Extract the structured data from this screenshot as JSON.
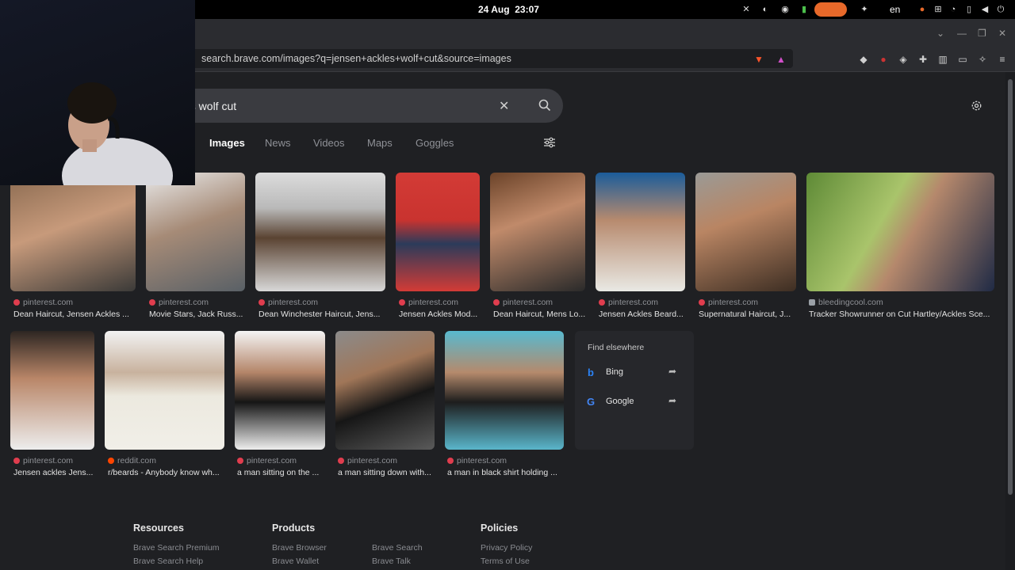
{
  "system": {
    "date": "24 Aug",
    "time": "23:07",
    "lang": "en"
  },
  "browser": {
    "url": "search.brave.com/images?q=jensen+ackles+wolf+cut&source=images"
  },
  "search": {
    "query_visible": "es wolf cut"
  },
  "tabs": [
    "Images",
    "News",
    "Videos",
    "Maps",
    "Goggles"
  ],
  "results_row1": [
    {
      "source": "pinterest.com",
      "caption": "Dean Haircut, Jensen Ackles ..."
    },
    {
      "source": "pinterest.com",
      "caption": "Movie Stars, Jack Russ..."
    },
    {
      "source": "pinterest.com",
      "caption": "Dean Winchester Haircut, Jens..."
    },
    {
      "source": "pinterest.com",
      "caption": "Jensen Ackles Mod..."
    },
    {
      "source": "pinterest.com",
      "caption": "Dean Haircut, Mens Lo..."
    },
    {
      "source": "pinterest.com",
      "caption": "Jensen Ackles Beard..."
    },
    {
      "source": "pinterest.com",
      "caption": "Supernatural Haircut, J..."
    },
    {
      "source": "bleedingcool.com",
      "caption": "Tracker Showrunner on Cut Hartley/Ackles Sce..."
    }
  ],
  "results_row2": [
    {
      "source": "pinterest.com",
      "caption": "Jensen ackles Jens..."
    },
    {
      "source": "reddit.com",
      "caption": "r/beards - Anybody know wh..."
    },
    {
      "source": "pinterest.com",
      "caption": "a man sitting on the ..."
    },
    {
      "source": "pinterest.com",
      "caption": "a man sitting down with..."
    },
    {
      "source": "pinterest.com",
      "caption": "a man in black shirt holding ..."
    }
  ],
  "find_elsewhere": {
    "title": "Find elsewhere",
    "items": [
      "Bing",
      "Google"
    ]
  },
  "footer": {
    "resources": {
      "title": "Resources",
      "links": [
        "Brave Search Premium",
        "Brave Search Help"
      ]
    },
    "products": {
      "title": "Products",
      "links": [
        "Brave Browser",
        "Brave Wallet",
        "Brave Search",
        "Brave Talk"
      ]
    },
    "policies": {
      "title": "Policies",
      "links": [
        "Privacy Policy",
        "Terms of Use"
      ]
    }
  },
  "colors": {
    "accent_orange": "#e8692a",
    "pinterest": "#e03d4e",
    "page_bg": "#1f2023"
  }
}
